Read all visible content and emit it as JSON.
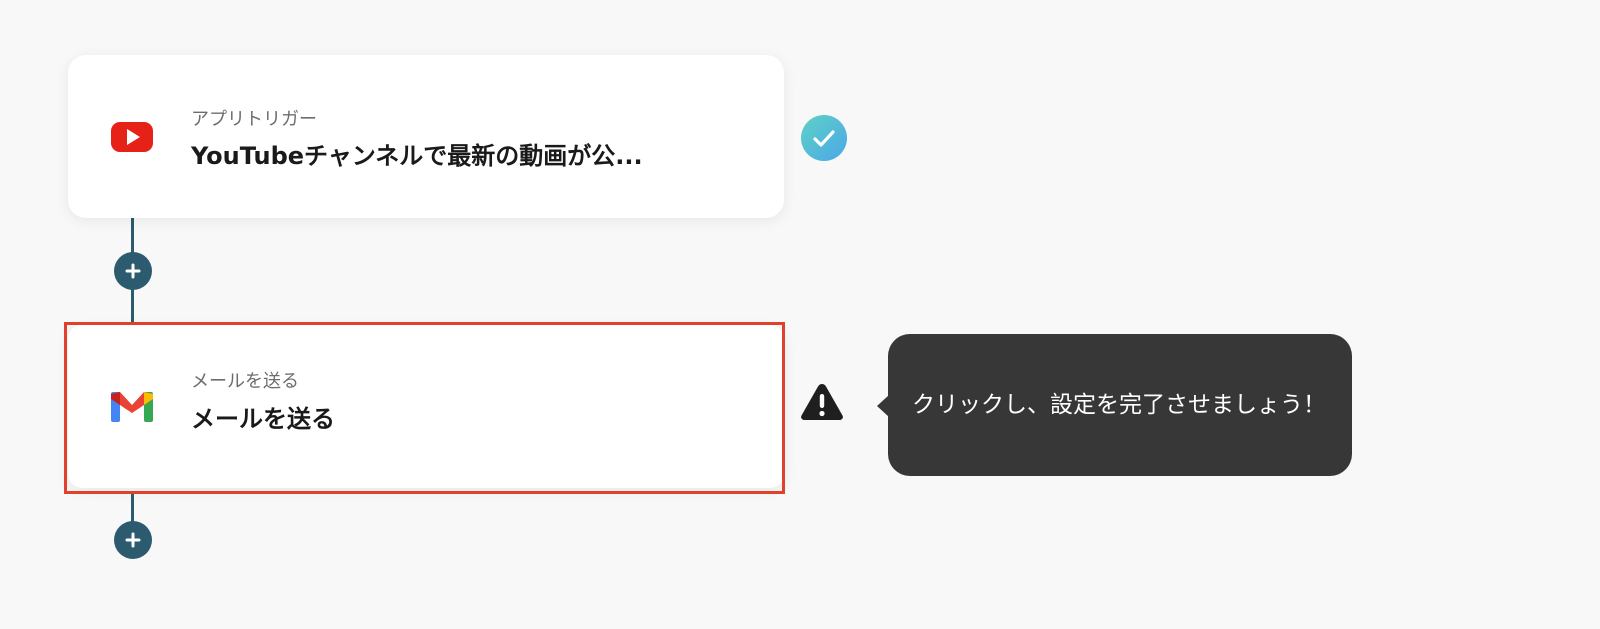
{
  "flow": {
    "steps": [
      {
        "type_label": "アプリトリガー",
        "title": "YouTubeチャンネルで最新の動画が公...",
        "icon": "youtube-icon",
        "status": "complete"
      },
      {
        "type_label": "メールを送る",
        "title": "メールを送る",
        "icon": "gmail-icon",
        "status": "incomplete"
      }
    ]
  },
  "tooltip": {
    "text": "クリックし、設定を完了させましょう！"
  },
  "colors": {
    "connector": "#2c5a6e",
    "highlight": "#e1402c",
    "check_gradient_start": "#5fd1c5",
    "check_gradient_end": "#4aa8e8",
    "tooltip_bg": "#373737"
  }
}
